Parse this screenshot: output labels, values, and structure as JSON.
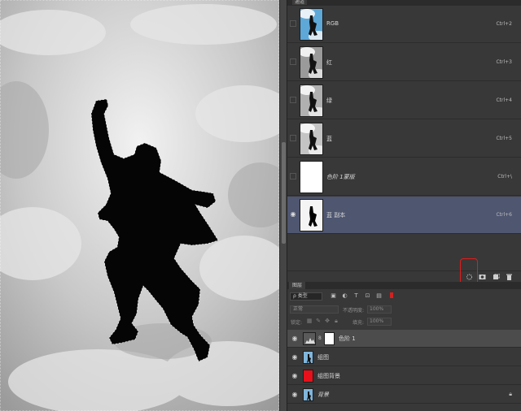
{
  "canvas": {
    "image": "jumping-man-silhouette-selection"
  },
  "channels_panel": {
    "tab_label": "通道",
    "channels": [
      {
        "name": "RGB",
        "shortcut": "Ctrl+2",
        "thumb": "color",
        "visible": false,
        "selected": false
      },
      {
        "name": "红",
        "shortcut": "Ctrl+3",
        "thumb": "gray",
        "visible": false,
        "selected": false
      },
      {
        "name": "绿",
        "shortcut": "Ctrl+4",
        "thumb": "gray",
        "visible": false,
        "selected": false
      },
      {
        "name": "蓝",
        "shortcut": "Ctrl+5",
        "thumb": "gray",
        "visible": false,
        "selected": false
      },
      {
        "name": "色阶 1蒙版",
        "shortcut": "Ctrl+\\",
        "thumb": "white",
        "visible": false,
        "selected": false
      },
      {
        "name": "蓝 副本",
        "shortcut": "Ctrl+6",
        "thumb": "silhouette",
        "visible": true,
        "selected": true
      }
    ],
    "footer_icons": [
      "load-selection-icon",
      "save-selection-icon",
      "new-channel-icon",
      "delete-channel-icon"
    ],
    "highlight_color": "#e01c1c"
  },
  "layers_panel": {
    "tab_label": "图层",
    "filter_kind": "ρ 类型",
    "filter_icons": [
      "image-filter-icon",
      "adjustment-filter-icon",
      "type-filter-icon",
      "shape-filter-icon",
      "smart-object-filter-icon"
    ],
    "blend_mode": "正常",
    "opacity_label": "不透明度:",
    "opacity_value": "100%",
    "lock_label": "锁定:",
    "fill_label": "填充:",
    "fill_value": "100%",
    "layers": [
      {
        "name": "色阶 1",
        "type": "adjustment",
        "selected": true,
        "locked": false
      },
      {
        "name": "组图",
        "type": "photo",
        "selected": false,
        "locked": false
      },
      {
        "name": "组图背景",
        "type": "red-fill",
        "selected": false,
        "locked": false
      },
      {
        "name": "背景",
        "type": "photo",
        "selected": false,
        "locked": true
      }
    ],
    "fill_color_red": "#e8101a"
  }
}
